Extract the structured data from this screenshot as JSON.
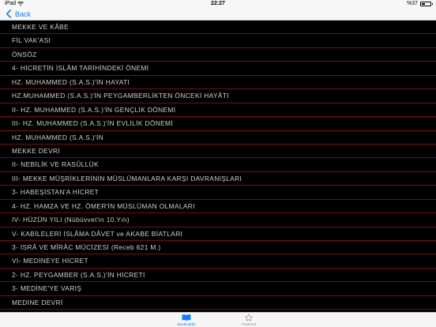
{
  "status": {
    "carrier": "iPad",
    "time": "22:27",
    "battery": "%37",
    "battery_level": 0.37
  },
  "nav": {
    "back_label": "Back"
  },
  "items": [
    "MEKKE VE KÂBE",
    "FİL VAK'ASI",
    "ÖNSÖZ",
    "4- HİCRETİN İSLÂM TARİHİNDEKİ ÖNEMİ",
    "HZ. MUHAMMED (S.A.S.)'İN HAYATI",
    "HZ.MUHAMMED (S.A.S.)'İN PEYGAMBERLİKTEN ÖNCEKİ HAYÂTI",
    "II- HZ. MUHAMMED (S.A.S.)'İN GENÇLİK DÖNEMİ",
    "III- HZ. MUHAMMED (S.A.S.)'İN EVLİLİK DÖNEMİ",
    "HZ. MUHAMMED (S.A.S.)'İN",
    "MEKKE DEVRİ",
    "II- NEBİLİK VE RASÛLLÜK",
    "III- MEKKE MÜŞRİKLERİNİN MÜSLÜMANLARA KARŞI DAVRANIŞLARI",
    "3- HABEŞİSTAN'A HİCRET",
    "4- HZ. HAMZA VE HZ. ÖMER'İN MÜSLÜMAN OLMALARI",
    "IV- HÜZÜN YILI (Nübüvvet'in 10.Yılı)",
    "V- KABİLELERİ İSLÂMA DÂVET ve AKABE BİATLARI",
    "3- İSRÂ VE MÎRÂC MÜCİZESİ (Receb 621 M.)",
    "VI- MEDİNEYE HİCRET",
    "2- HZ. PEYGAMBER (S.A.S.)'İN HİCRETİ",
    "3- MEDİNE'YE VARIŞ",
    "MEDİNE DEVRİ"
  ],
  "tabs": {
    "bookmarks_label": "Bookmarks",
    "featured_label": "Featured"
  },
  "colors": {
    "accent": "#147efb",
    "separator": "#7a0d0d",
    "background": "#000000"
  }
}
